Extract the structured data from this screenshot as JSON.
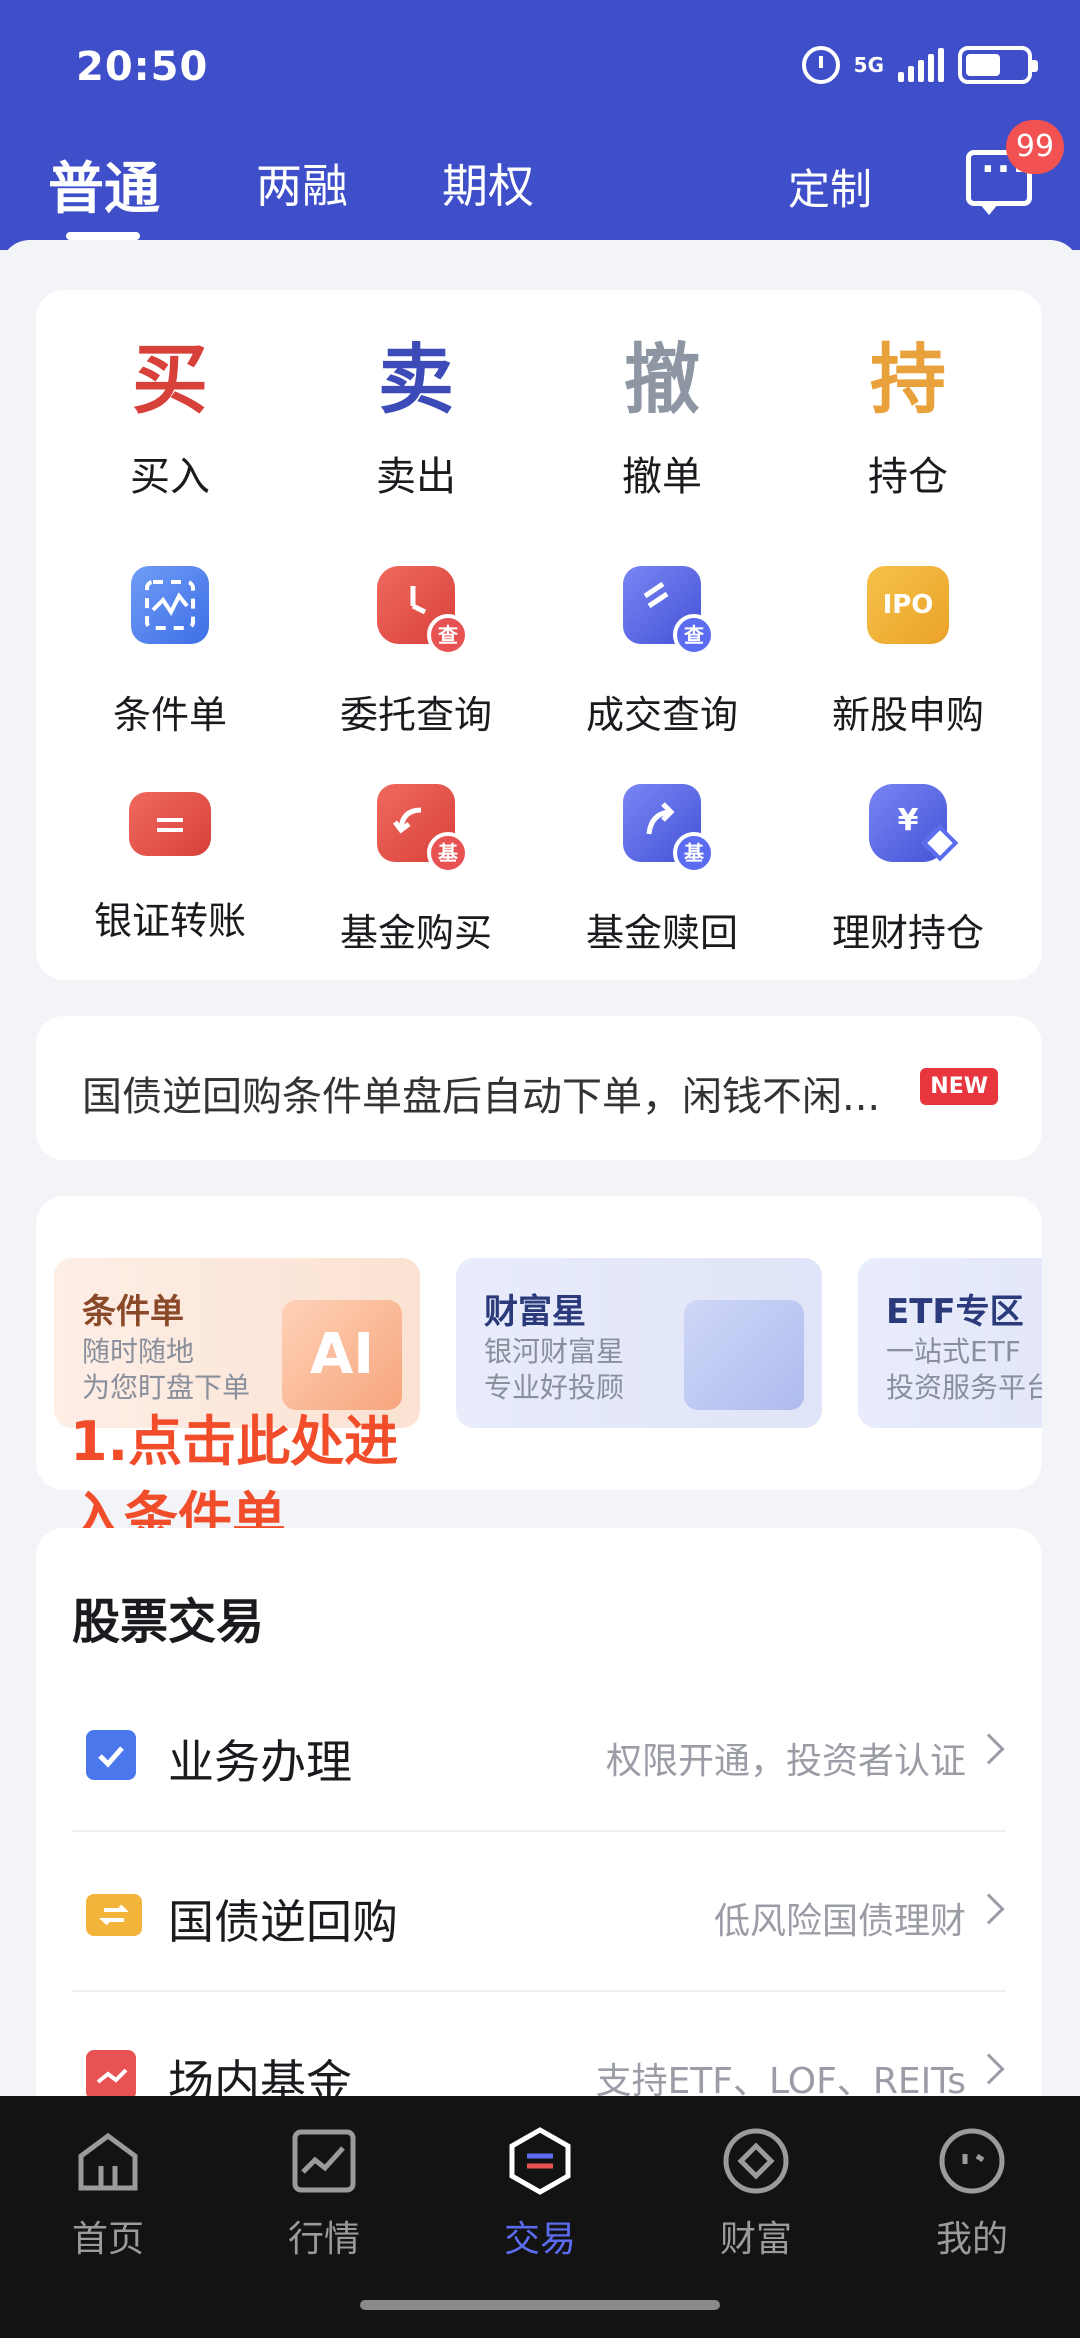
{
  "status_bar": {
    "time": "20:50",
    "network": "5G",
    "signal_icon": "signal-icon",
    "battery_icon": "battery-icon",
    "alarm_icon": "alarm-icon"
  },
  "top_tabs": [
    {
      "label": "普通",
      "active": true
    },
    {
      "label": "两融",
      "active": false
    },
    {
      "label": "期权",
      "active": false
    }
  ],
  "header": {
    "custom_label": "定制",
    "message_icon": "message-icon",
    "message_badge": "99"
  },
  "quick_actions": [
    {
      "char": "买",
      "label": "买入",
      "color": "#d8403a"
    },
    {
      "char": "卖",
      "label": "卖出",
      "color": "#3d4bb8"
    },
    {
      "char": "撤",
      "label": "撤单",
      "color": "#8e95a3"
    },
    {
      "char": "持",
      "label": "持仓",
      "color": "#e9a23b"
    }
  ],
  "icon_actions_row1": [
    {
      "label": "条件单",
      "icon": "condition-order-icon"
    },
    {
      "label": "委托查询",
      "icon": "entrust-query-icon"
    },
    {
      "label": "成交查询",
      "icon": "deal-query-icon"
    },
    {
      "label": "新股申购",
      "icon": "ipo-icon",
      "icon_text": "IPO"
    }
  ],
  "icon_actions_row2": [
    {
      "label": "银证转账",
      "icon": "bank-transfer-icon"
    },
    {
      "label": "基金购买",
      "icon": "fund-buy-icon"
    },
    {
      "label": "基金赎回",
      "icon": "fund-redeem-icon"
    },
    {
      "label": "理财持仓",
      "icon": "wealth-holding-icon"
    }
  ],
  "sub_badges": {
    "query": "查",
    "fund": "基",
    "yen": "¥"
  },
  "notice": {
    "text": "国债逆回购条件单盘后自动下单，闲钱不闲...",
    "tag": "NEW"
  },
  "promos": [
    {
      "title": "条件单",
      "line1": "随时随地",
      "line2": "为您盯盘下单",
      "art_text": "AI"
    },
    {
      "title": "财富星",
      "line1": "银河财富星",
      "line2": "专业好投顾"
    },
    {
      "title": "ETF专区",
      "line1": "一站式ETF",
      "line2": "投资服务平台"
    }
  ],
  "annotation": {
    "line1": "1.点击此处进",
    "line2": "入条件单"
  },
  "stock_trading": {
    "title": "股票交易",
    "rows": [
      {
        "label": "业务办理",
        "hint": "权限开通，投资者认证",
        "icon": "business-icon"
      },
      {
        "label": "国债逆回购",
        "hint": "低风险国债理财",
        "icon": "repo-icon"
      },
      {
        "label": "场内基金",
        "hint": "支持ETF、LOF、REITs",
        "icon": "exchange-fund-icon"
      }
    ]
  },
  "bottom_nav": [
    {
      "label": "首页",
      "icon": "home-icon",
      "active": false
    },
    {
      "label": "行情",
      "icon": "market-icon",
      "active": false
    },
    {
      "label": "交易",
      "icon": "trade-icon",
      "active": true
    },
    {
      "label": "财富",
      "icon": "wealth-icon",
      "active": false
    },
    {
      "label": "我的",
      "icon": "profile-icon",
      "active": false
    }
  ]
}
